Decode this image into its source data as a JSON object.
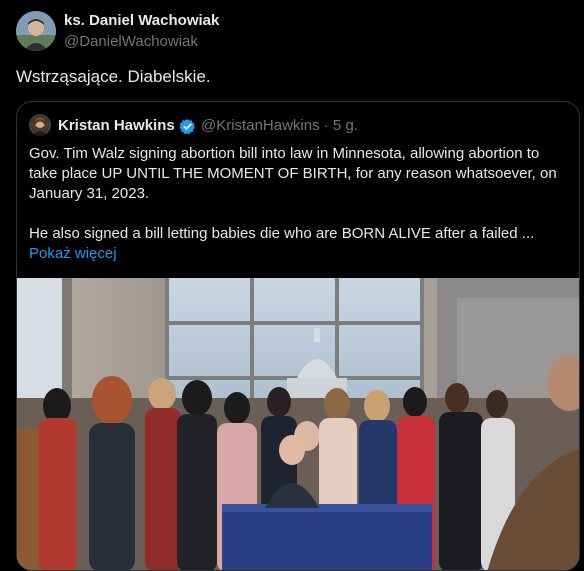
{
  "post": {
    "author_name": "ks. Daniel Wachowiak",
    "author_handle": "@DanielWachowiak",
    "text": "Wstrząsające. Diabelskie."
  },
  "quoted": {
    "author_name": "Kristan Hawkins",
    "author_handle": "@KristanHawkins",
    "time": "· 5 g.",
    "paragraph1": "Gov. Tim Walz signing abortion bill into law in Minnesota, allowing abortion to take place UP UNTIL THE MOMENT OF BIRTH, for any reason whatsoever, on January 31, 2023.",
    "paragraph2": "He also signed a bill letting babies die who are BORN ALIVE after a failed ...",
    "show_more": "Pokaż więcej"
  },
  "colors": {
    "background": "#000000",
    "text": "#e7e9ea",
    "muted": "#71767b",
    "link": "#1d9bf0",
    "border": "#2f3336",
    "verified": "#1d9bf0"
  },
  "icons": {
    "verified": "verified-badge-icon"
  }
}
